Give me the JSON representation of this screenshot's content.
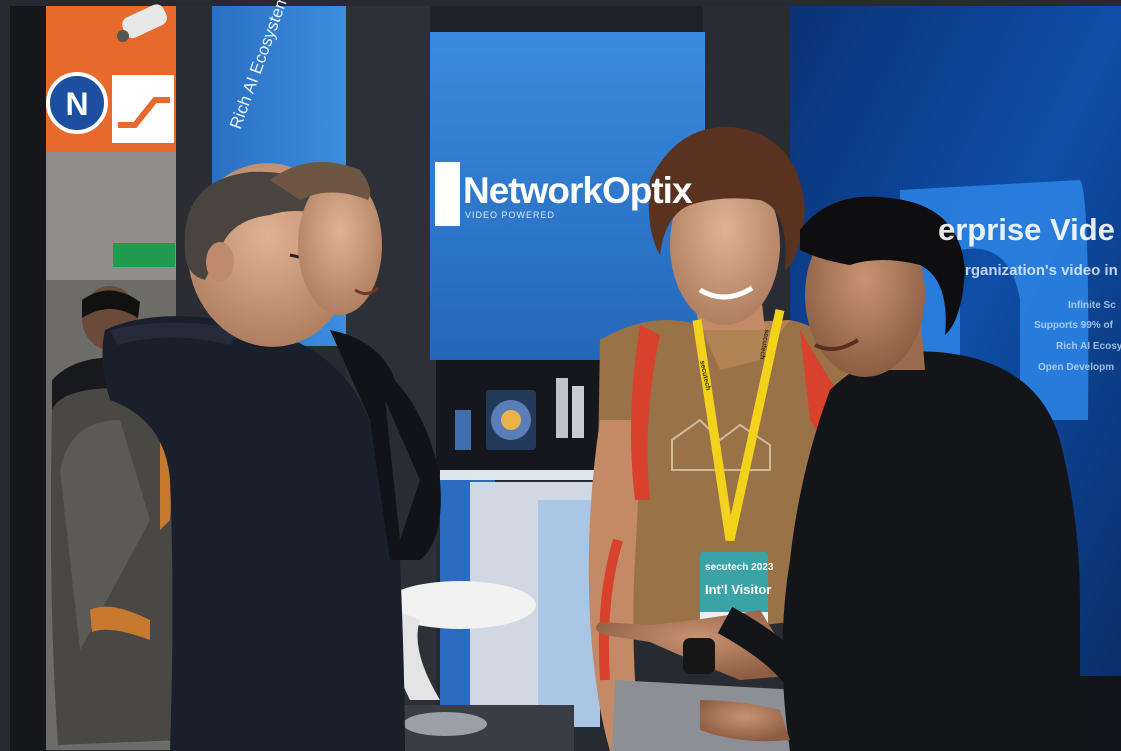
{
  "booth": {
    "brand_name": "NetworkOptix",
    "brand_tagline": "VIDEO POWERED",
    "side_panel_text": "Rich AI Ecosystem",
    "banner_title": "erprise Vide",
    "banner_subtitle": "rganization's video in",
    "banner_bullets": [
      "Infinite Sc",
      "Supports 99% of",
      "Rich AI Ecosy",
      "Open Developm"
    ]
  },
  "badge": {
    "event": "secutech 2023",
    "type": "Int'l Visitor",
    "lanyard_text": "secutech"
  },
  "signage": {
    "letter": "N"
  },
  "colors": {
    "booth_blue": "#2f7fd6",
    "banner_navy": "#0b3d8c",
    "lanyard_yellow": "#f2d21a",
    "badge_teal": "#3aa3a8",
    "sign_orange": "#e8692c"
  }
}
